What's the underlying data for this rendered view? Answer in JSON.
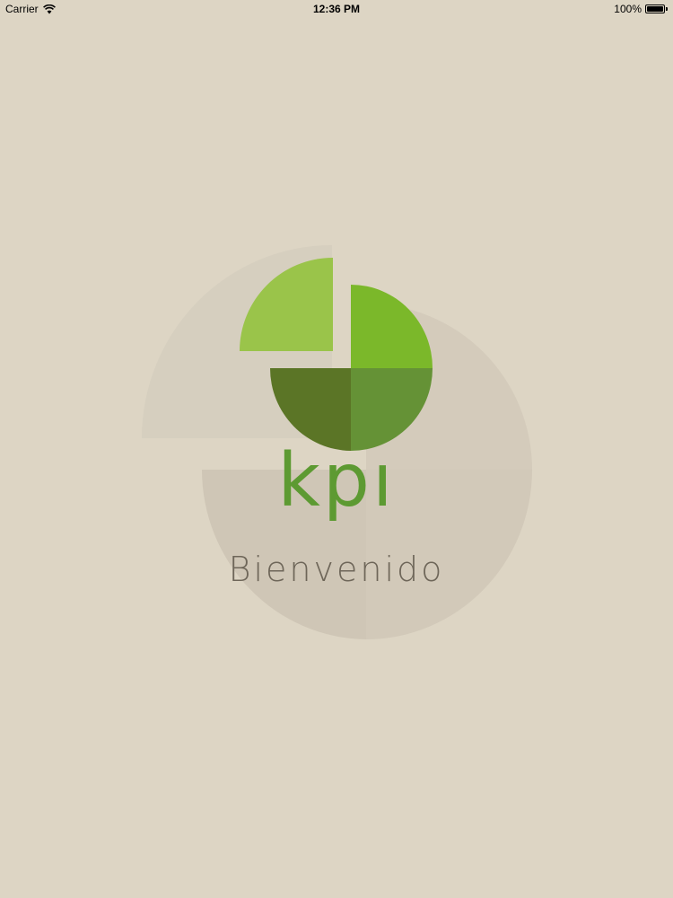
{
  "status_bar": {
    "carrier": "Carrier",
    "time": "12:36 PM",
    "battery": "100%",
    "battery_level": 1.0
  },
  "splash": {
    "brand": "kpı",
    "welcome": "Bienvenido"
  },
  "colors": {
    "background": "#ddd5c4",
    "brand_green": "#5d9a32",
    "light_green": "#9ac44a",
    "bright_green": "#7bb82a",
    "dark_green": "#5b7526",
    "mid_green": "#659236",
    "welcome_text": "#6e6659"
  },
  "icons": [
    "wifi-icon",
    "battery-icon",
    "kpi-pie-logo"
  ]
}
